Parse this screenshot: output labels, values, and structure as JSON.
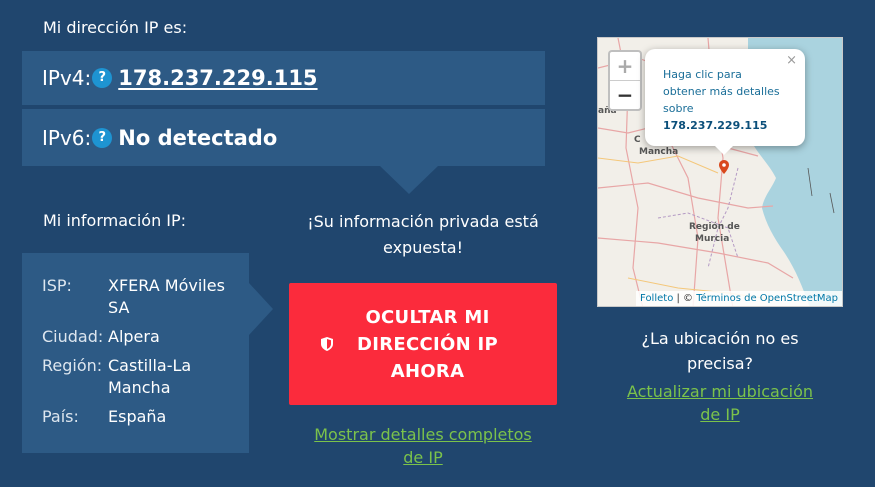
{
  "ip_section": {
    "heading": "Mi dirección IP es:",
    "ipv4_label": "IPv4:",
    "ipv4_value": "178.237.229.115",
    "ipv6_label": "IPv6:",
    "ipv6_value": "No detectado",
    "help_glyph": "?"
  },
  "info_section": {
    "heading": "Mi información IP:",
    "rows": [
      {
        "key": "ISP:",
        "value": "XFERA Móviles SA"
      },
      {
        "key": "Ciudad:",
        "value": "Alpera"
      },
      {
        "key": "Región:",
        "value": "Castilla-La Mancha"
      },
      {
        "key": "País:",
        "value": "España"
      }
    ]
  },
  "warning": {
    "line1": "¡Su información privada está",
    "line2": "expuesta!"
  },
  "cta": {
    "line1": "OCULTAR MI",
    "line2": "DIRECCIÓN IP",
    "line3": "AHORA",
    "icon": "shield-icon"
  },
  "details_link": {
    "line1": "Mostrar detalles completos",
    "line2": "de IP"
  },
  "map": {
    "zoom_in": "+",
    "zoom_out": "−",
    "popup_line1": "Haga clic para",
    "popup_line2": "obtener más detalles",
    "popup_line3": "sobre",
    "popup_ip": "178.237.229.115",
    "popup_close": "×",
    "attribution_leaflet": "Folleto",
    "attribution_sep": "| ©",
    "attribution_osm": "Términos de OpenStreetMap",
    "labels": {
      "edge_top": "aña",
      "castilla_1": "C",
      "castilla_2": "Mancha",
      "murcia_1": "Región de",
      "murcia_2": "Murcia"
    }
  },
  "location_question": {
    "line1": "¿La ubicación no es",
    "line2": "precisa?"
  },
  "update_link": {
    "line1": "Actualizar mi ubicación",
    "line2": "de IP"
  },
  "colors": {
    "background": "#20466e",
    "panel": "#2d5a85",
    "cta": "#fb2b3c",
    "link": "#7bc24b",
    "help_icon": "#1e94d2",
    "map_sea": "#aad3df",
    "map_pin": "#d9481c"
  }
}
